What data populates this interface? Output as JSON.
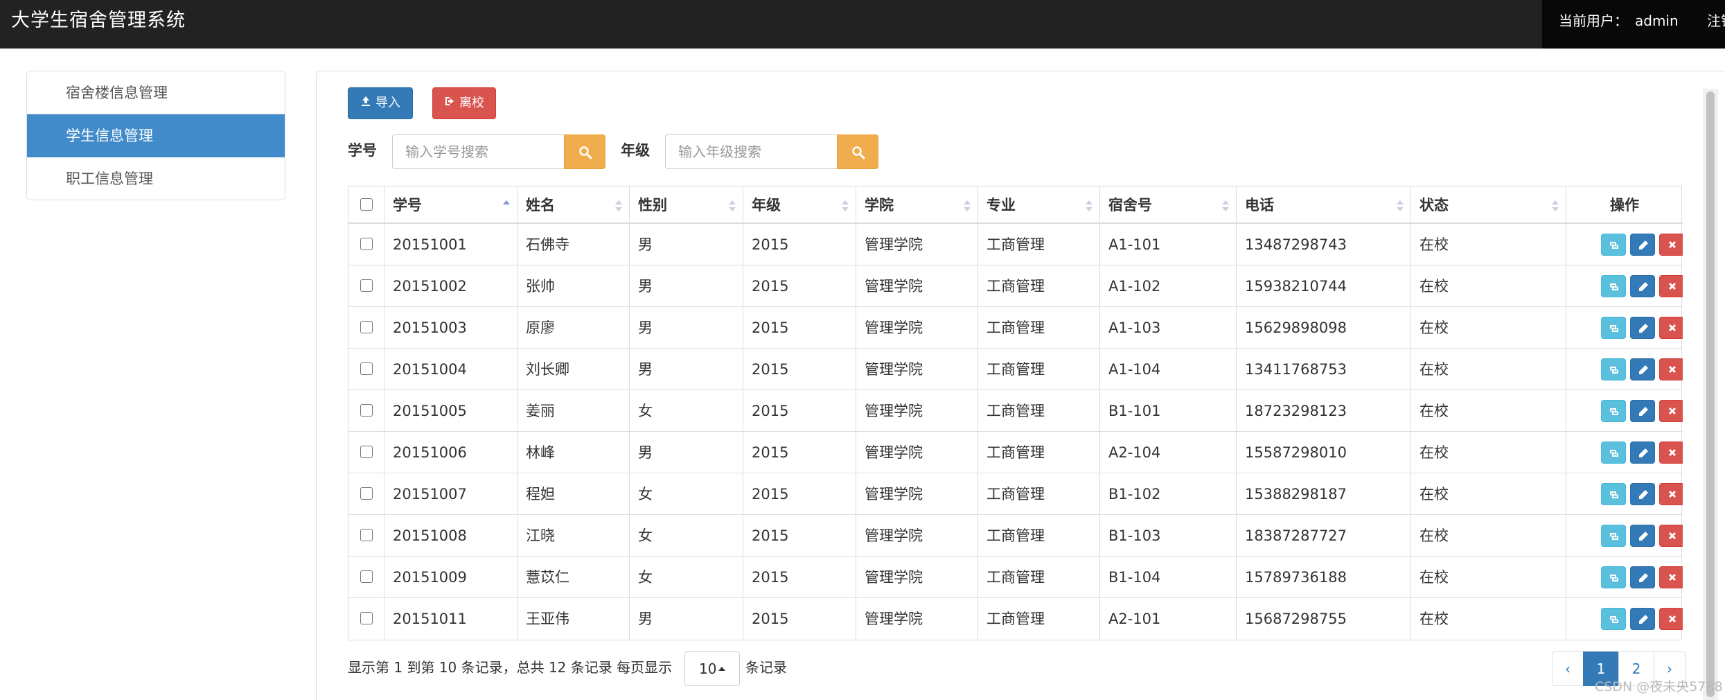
{
  "app": {
    "title": "大学生宿舍管理系统"
  },
  "header": {
    "current_user_label": "当前用户：",
    "username": "admin",
    "logout": "注销"
  },
  "sidebar": {
    "items": [
      {
        "label": "宿舍楼信息管理",
        "active": false
      },
      {
        "label": "学生信息管理",
        "active": true
      },
      {
        "label": "职工信息管理",
        "active": false
      }
    ]
  },
  "toolbar": {
    "import_label": "导入",
    "leave_label": "离校"
  },
  "search": {
    "student_id_label": "学号",
    "student_id_placeholder": "输入学号搜索",
    "grade_label": "年级",
    "grade_placeholder": "输入年级搜索"
  },
  "table": {
    "columns": [
      "学号",
      "姓名",
      "性别",
      "年级",
      "学院",
      "专业",
      "宿舍号",
      "电话",
      "状态",
      "操作"
    ],
    "sort": {
      "column": "学号",
      "direction": "asc"
    },
    "rows": [
      [
        "20151001",
        "石佛寺",
        "男",
        "2015",
        "管理学院",
        "工商管理",
        "A1-101",
        "13487298743",
        "在校"
      ],
      [
        "20151002",
        "张帅",
        "男",
        "2015",
        "管理学院",
        "工商管理",
        "A1-102",
        "15938210744",
        "在校"
      ],
      [
        "20151003",
        "原廖",
        "男",
        "2015",
        "管理学院",
        "工商管理",
        "A1-103",
        "15629898098",
        "在校"
      ],
      [
        "20151004",
        "刘长卿",
        "男",
        "2015",
        "管理学院",
        "工商管理",
        "A1-104",
        "13411768753",
        "在校"
      ],
      [
        "20151005",
        "姜丽",
        "女",
        "2015",
        "管理学院",
        "工商管理",
        "B1-101",
        "18723298123",
        "在校"
      ],
      [
        "20151006",
        "林峰",
        "男",
        "2015",
        "管理学院",
        "工商管理",
        "A2-104",
        "15587298010",
        "在校"
      ],
      [
        "20151007",
        "程妲",
        "女",
        "2015",
        "管理学院",
        "工商管理",
        "B1-102",
        "15388298187",
        "在校"
      ],
      [
        "20151008",
        "江晓",
        "女",
        "2015",
        "管理学院",
        "工商管理",
        "B1-103",
        "18387287727",
        "在校"
      ],
      [
        "20151009",
        "薏苡仁",
        "女",
        "2015",
        "管理学院",
        "工商管理",
        "B1-104",
        "15789736188",
        "在校"
      ],
      [
        "20151011",
        "王亚伟",
        "男",
        "2015",
        "管理学院",
        "工商管理",
        "A2-101",
        "15687298755",
        "在校"
      ]
    ]
  },
  "pagination": {
    "info": "显示第 1 到第 10 条记录，总共 12 条记录 每页显示",
    "page_size": "10",
    "suffix": "条记录",
    "prev": "‹",
    "next": "›",
    "pages": [
      "1",
      "2"
    ],
    "current": "1"
  },
  "watermark": "CSDN @夜未央5788",
  "colors": {
    "topbar": "#222222",
    "primary": "#337ab7",
    "active_nav": "#428bca",
    "danger": "#d9534f",
    "warning": "#f0ad4e",
    "info": "#5bc0de"
  }
}
